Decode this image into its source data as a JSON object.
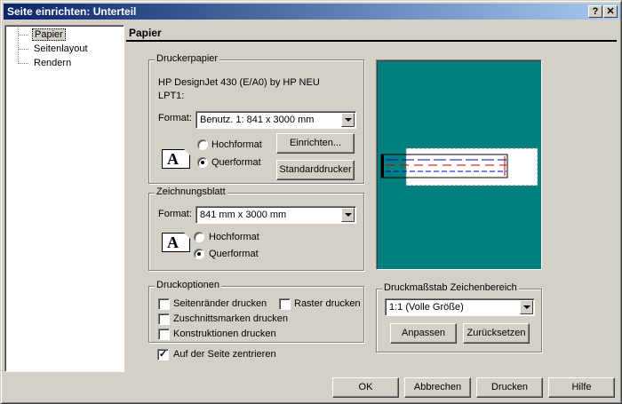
{
  "window": {
    "title": "Seite einrichten: Unterteil",
    "help_glyph": "?",
    "close_glyph": "✕"
  },
  "tree": {
    "items": [
      {
        "label": "Papier",
        "selected": true
      },
      {
        "label": "Seitenlayout",
        "selected": false
      },
      {
        "label": "Rendern",
        "selected": false
      }
    ]
  },
  "panel": {
    "title": "Papier"
  },
  "druckerpapier": {
    "group_label": "Druckerpapier",
    "printer_name": "HP DesignJet 430 (E/A0) by HP NEU",
    "port": "LPT1:",
    "format_label": "Format:",
    "format_value": "Benutz. 1: 841 x 3000 mm",
    "hochformat_label": "Hochformat",
    "querformat_label": "Querformat",
    "orientation": "Querformat",
    "einrichten_button": "Einrichten...",
    "standarddrucker_button": "Standarddrucker",
    "icon_letter": "A"
  },
  "zeichnungsblatt": {
    "group_label": "Zeichnungsblatt",
    "format_label": "Format:",
    "format_value": "841 mm x 3000 mm",
    "hochformat_label": "Hochformat",
    "querformat_label": "Querformat",
    "orientation": "Querformat",
    "icon_letter": "A"
  },
  "druckoptionen": {
    "group_label": "Druckoptionen",
    "options": [
      {
        "label": "Seitenränder drucken",
        "checked": false
      },
      {
        "label": "Raster drucken",
        "checked": false
      },
      {
        "label": "Zuschnittsmarken drucken",
        "checked": false
      },
      {
        "label": "Konstruktionen drucken",
        "checked": false
      }
    ]
  },
  "center": {
    "label": "Auf der Seite zentrieren",
    "checked": true,
    "check_glyph": "✓"
  },
  "druckmassstab": {
    "group_label": "Druckmaßstab Zeichenbereich",
    "scale_value": "1:1 (Volle Größe)",
    "anpassen_button": "Anpassen",
    "zuruecksetzen_button": "Zurücksetzen"
  },
  "footer": {
    "ok": "OK",
    "abbrechen": "Abbrechen",
    "drucken": "Drucken",
    "hilfe": "Hilfe"
  },
  "colors": {
    "title_gradient_start": "#0a246a",
    "title_gradient_end": "#a6caf0",
    "preview_bg": "#007f7f",
    "dialog_bg": "#d4d0c8"
  }
}
